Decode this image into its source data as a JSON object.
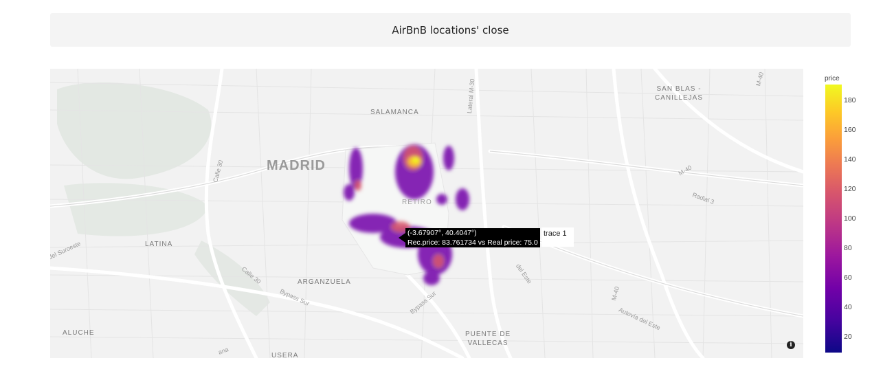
{
  "title": "AirBnB locations' close",
  "colorbar": {
    "title": "price",
    "ticks": [
      "180",
      "160",
      "140",
      "120",
      "100",
      "80",
      "60",
      "40",
      "20"
    ]
  },
  "places": {
    "madrid": "MADRID",
    "salamanca": "SALAMANCA",
    "san_blas": "SAN BLAS -\nCANILLEJAS",
    "retiro": "RETIRO",
    "latina": "LATINA",
    "arganzuela": "ARGANZUELA",
    "aluche": "ALUCHE",
    "puente_vallecas": "PUENTE DE\nVALLECAS",
    "usera": "USERA"
  },
  "roads": {
    "calle30_a": "Calle 30",
    "calle30_b": "Calle 30",
    "m40_a": "M-40",
    "m40_b": "M-40",
    "m40_c": "M-40",
    "radial3": "Radial 3",
    "suroeste": "del Suroeste",
    "bypass_sur_a": "Bypass Sur",
    "bypass_sur_b": "Bypass Sur",
    "autovia_este": "Autovía del Este",
    "del_este": "del Este",
    "lateral_m30": "Lateral M-30",
    "ana": "ana"
  },
  "tooltip": {
    "coords": "(-3.67907°, 40.4047°)",
    "text": "Rec.price: 83.761734 vs Real price: 75.0",
    "trace": "trace 1"
  },
  "colors": {
    "low": "#0d0887",
    "mid": "#bd3786",
    "high": "#f0f921"
  }
}
